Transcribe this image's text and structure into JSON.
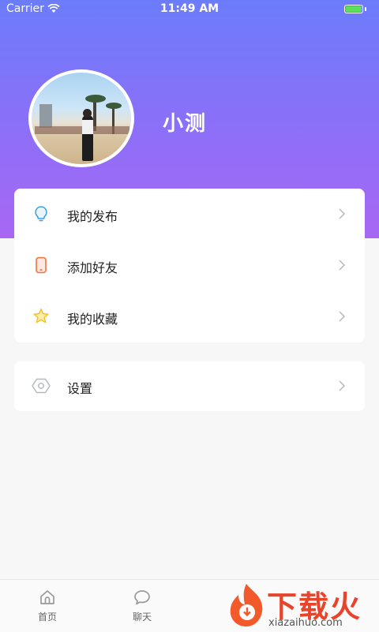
{
  "status_bar": {
    "carrier": "Carrier",
    "time": "11:49 AM"
  },
  "profile": {
    "username": "小测",
    "avatar_icon": "avatar-photo"
  },
  "menu_group_1": [
    {
      "label": "我的发布",
      "icon": "lightbulb-icon",
      "color": "#3aa0e6"
    },
    {
      "label": "添加好友",
      "icon": "phone-icon",
      "color": "#f0733f"
    },
    {
      "label": "我的收藏",
      "icon": "star-icon",
      "color": "#f5c12d"
    }
  ],
  "menu_group_2": [
    {
      "label": "设置",
      "icon": "settings-hexagon-icon",
      "color": "#b5b9c6"
    }
  ],
  "tab_bar": [
    {
      "label": "首页",
      "icon": "home-icon"
    },
    {
      "label": "聊天",
      "icon": "chat-bubble-icon"
    }
  ],
  "watermark": {
    "brand": "下载火",
    "url": "xiazaihuo.com"
  },
  "colors": {
    "header_gradient_top": "#6b7cfb",
    "header_gradient_bottom": "#a867f3",
    "background": "#f7f7f8"
  }
}
